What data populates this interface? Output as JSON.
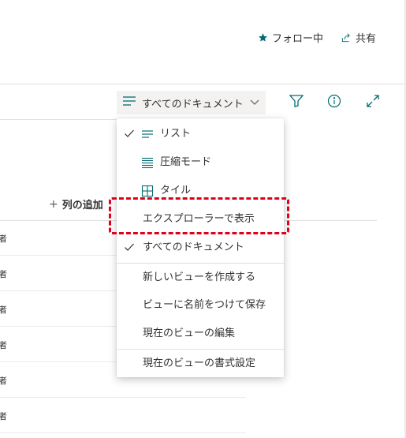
{
  "header": {
    "follow_label": "フォロー中",
    "share_label": "共有"
  },
  "command_bar": {
    "view_selector_label": "すべてのドキュメント"
  },
  "list": {
    "add_column_label": "列の追加",
    "row_fragment": "者",
    "row_count": 6
  },
  "view_menu": {
    "items": [
      {
        "label": "リスト",
        "icon": "list-icon",
        "checked": true
      },
      {
        "label": "圧縮モード",
        "icon": "compact-list-icon",
        "checked": false
      },
      {
        "label": "タイル",
        "icon": "tiles-icon",
        "checked": false
      },
      {
        "label": "エクスプローラーで表示",
        "icon": "",
        "checked": false
      },
      {
        "label": "すべてのドキュメント",
        "icon": "",
        "checked": true
      },
      {
        "label": "新しいビューを作成する",
        "icon": "",
        "checked": false
      },
      {
        "label": "ビューに名前をつけて保存",
        "icon": "",
        "checked": false
      },
      {
        "label": "現在のビューの編集",
        "icon": "",
        "checked": false
      },
      {
        "label": "現在のビューの書式設定",
        "icon": "",
        "checked": false
      }
    ]
  },
  "colors": {
    "accent": "#036c70",
    "highlight": "#e0001a"
  }
}
